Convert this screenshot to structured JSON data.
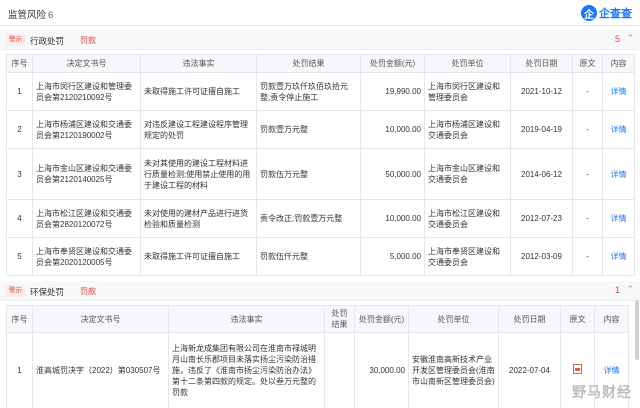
{
  "header": {
    "title": "监管风险",
    "count": "6",
    "logo_mark": "企",
    "logo_text": "企查查"
  },
  "admin_penalty": {
    "tag": "警示",
    "title": "行政处罚",
    "filter": "罚款",
    "count": "5",
    "toggle": "⌃",
    "columns": [
      "序号",
      "决定文书号",
      "违法事实",
      "处罚结果",
      "处罚金额(元)",
      "处罚单位",
      "处罚日期",
      "原文",
      "内容"
    ],
    "rows": [
      {
        "no": "1",
        "doc": "上海市闵行区建设和管理委员会第2120210092号",
        "fact": "未取得施工许可证擅自施工",
        "result": "罚款壹万玖仟玖佰玖拾元整;责令停止施工",
        "amount": "19,990.00",
        "unit": "上海市闵行区建设和管理委员会",
        "date": "2021-10-12",
        "original": "-",
        "detail": "详情"
      },
      {
        "no": "2",
        "doc": "上海市杨浦区建设和交通委员会第2120190002号",
        "fact": "对违反建设工程建设程序管理规定的处罚",
        "result": "罚款壹万元整",
        "amount": "10,000.00",
        "unit": "上海市杨浦区建设和交通委员会",
        "date": "2019-04-19",
        "original": "-",
        "detail": "详情"
      },
      {
        "no": "3",
        "doc": "上海市金山区建设和交通委员会第2120140025号",
        "fact": "未对其使用的建设工程材料进行质量检测;使用禁止使用的用于建设工程的材料",
        "result": "罚款伍万元整",
        "amount": "50,000.00",
        "unit": "上海市金山区建设和交通委员会",
        "date": "2014-06-12",
        "original": "-",
        "detail": "详情"
      },
      {
        "no": "4",
        "doc": "上海市松江区建设和交通委员会第2820120072号",
        "fact": "未对使用的建材产品进行进货检验和质量检测",
        "result": "责令改正;罚款壹万元整",
        "amount": "10,000.00",
        "unit": "上海市松江区建设和交通委员会",
        "date": "2012-07-23",
        "original": "-",
        "detail": "详情"
      },
      {
        "no": "5",
        "doc": "上海市奉贤区建设和交通委员会第2020120005号",
        "fact": "未取得施工许可证擅自施工",
        "result": "罚款伍仟元整",
        "amount": "5,000.00",
        "unit": "上海市奉贤区建设和交通委员会",
        "date": "2012-03-09",
        "original": "-",
        "detail": "详情"
      }
    ]
  },
  "env_penalty": {
    "tag": "警示",
    "title": "环保处罚",
    "filter": "罚款",
    "count": "1",
    "toggle": "⌃",
    "columns": [
      "序号",
      "决定文书号",
      "违法事实",
      "处罚结果",
      "处罚金额(元)",
      "处罚单位",
      "处罚日期",
      "原文",
      "内容"
    ],
    "rows": [
      {
        "no": "1",
        "doc": "淮高城罚决字（2022）第030507号",
        "fact": "上海新龙成集团有限公司在淮南市禄城明月山南长乐郡项目未落实扬尘污染防治措施，违反了《淮南市扬尘污染防治办法》第十二条第四款的规定。处以叁万元整的罚款",
        "result": "",
        "amount": "30,000.00",
        "unit": "安徽淮南高新技术产业开发区管理委员会(淮南市山南新区管理委员会)",
        "date": "2022-07-04",
        "original": "pdf-icon",
        "detail": "详情"
      }
    ]
  },
  "watermark": "野马财经"
}
